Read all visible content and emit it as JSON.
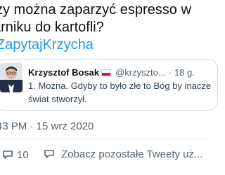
{
  "tweet": {
    "text_line_1": "zy można zaparzyć espresso w",
    "text_line_2": "arniku do kartofli?",
    "hashtag": "ZapytajKrzycha",
    "meta": "43 PM · 15 wrz 2020"
  },
  "reply": {
    "author_name": "Krzysztof Bosak",
    "author_handle": "@krzyszto...",
    "timestamp": "· 18 g.",
    "text_line_1": "1. Można. Gdyby to było złe to Bóg by inacze",
    "text_line_2": "świat stworzył.",
    "flag_colors": {
      "top": "#ffffff",
      "bottom": "#dc143c"
    }
  },
  "actions": {
    "reply_count": "10",
    "more_tweets_label": "Zobacz pozostałe Tweety uż..."
  },
  "icons": {
    "reply": "reply-icon",
    "chat": "chat-icon",
    "avatar": "avatar"
  }
}
